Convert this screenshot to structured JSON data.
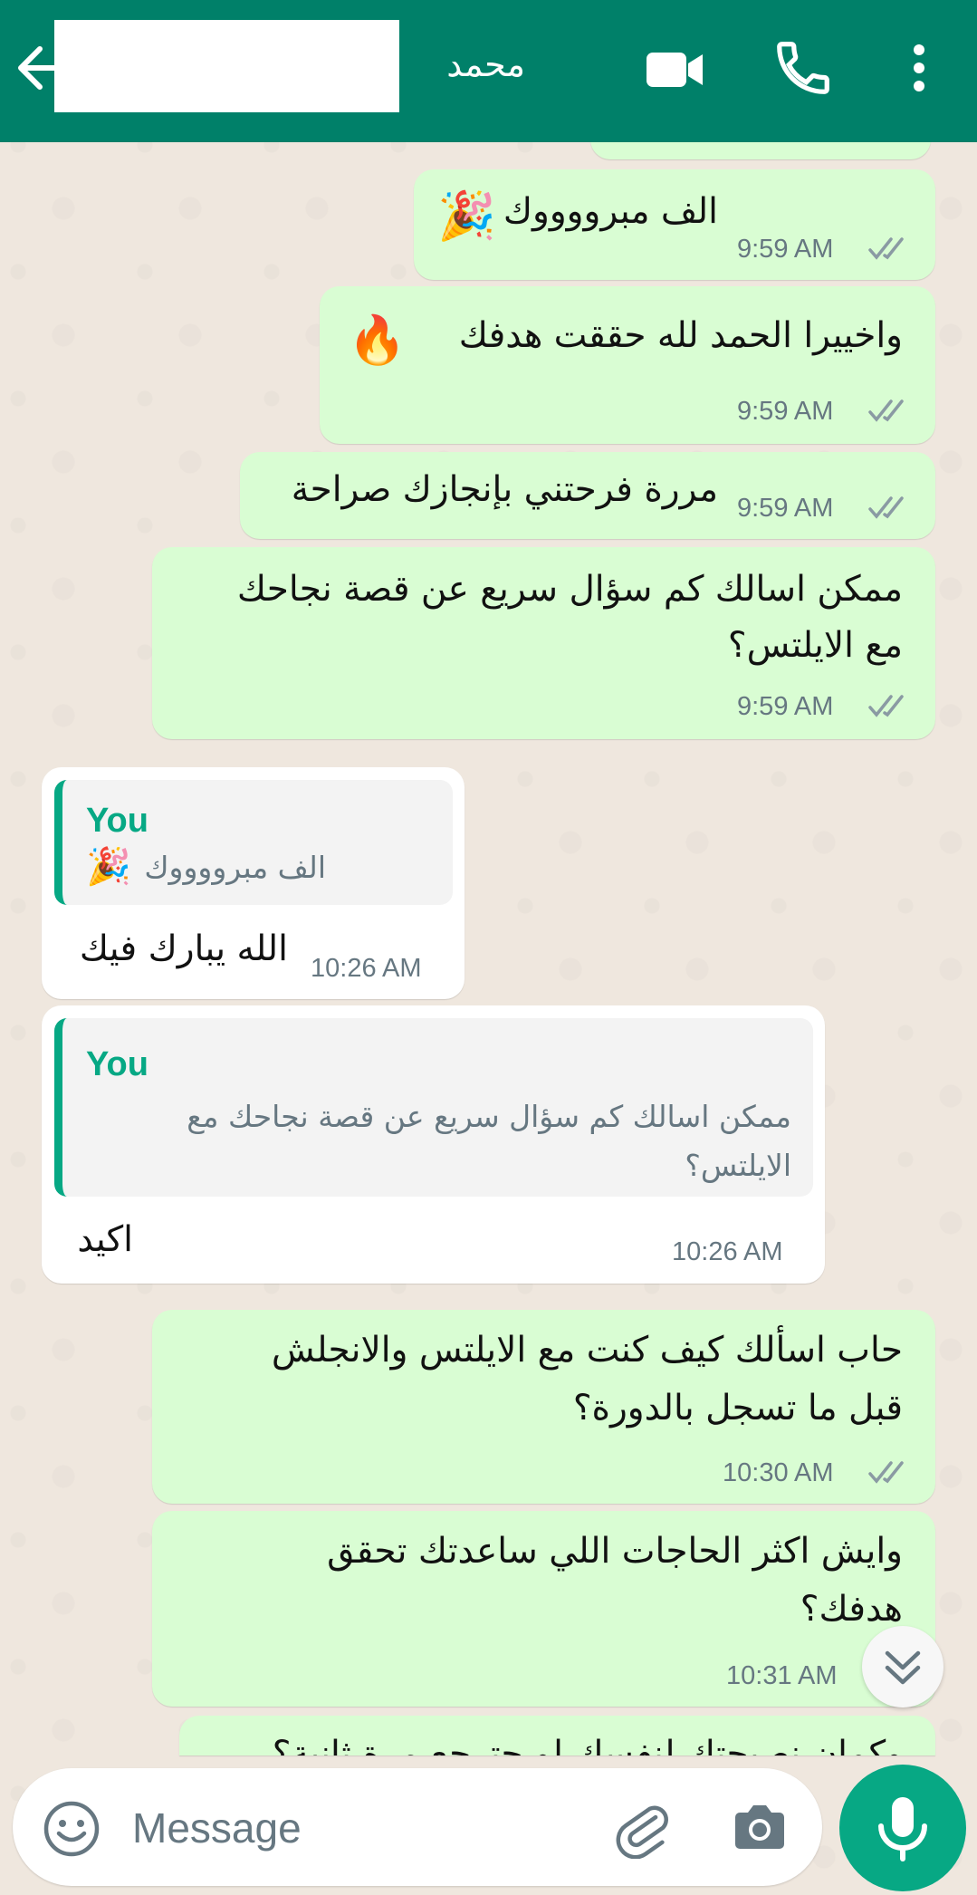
{
  "header": {
    "contact_name": "محمد",
    "back_label": "back",
    "icons": [
      "arrow-left-icon",
      "video-call-icon",
      "phone-icon",
      "more-vert-icon"
    ]
  },
  "messages": [
    {
      "text": "الف مبرووووك",
      "emoji": "🎉",
      "time": "9:59 AM",
      "direction": "out",
      "status": "read"
    },
    {
      "text": "واخييرا الحمد لله حققت هدفك",
      "emoji": "🔥",
      "time": "9:59 AM",
      "direction": "out",
      "status": "read"
    },
    {
      "text": "مررة فرحتني بإنجازك صراحة",
      "time": "9:59 AM",
      "direction": "out",
      "status": "read"
    },
    {
      "lines": [
        "ممكن اسالك كم سؤال سريع عن قصة نجاحك",
        "مع الايلتس؟"
      ],
      "time": "9:59 AM",
      "direction": "out",
      "status": "read"
    },
    {
      "quote_author": "You",
      "quote_text": "الف مبرووووك",
      "quote_emoji": "🎉",
      "text": "الله يبارك فيك",
      "time": "10:26 AM",
      "direction": "in"
    },
    {
      "quote_author": "You",
      "quote_lines": [
        "ممكن اسالك كم سؤال سريع عن قصة نجاحك مع",
        "الايلتس؟"
      ],
      "text": "اكيد",
      "time": "10:26 AM",
      "direction": "in"
    },
    {
      "lines": [
        "حاب اسألك كيف كنت مع الايلتس والانجلش",
        "قبل ما تسجل بالدورة؟"
      ],
      "time": "10:30 AM",
      "direction": "out",
      "status": "read"
    },
    {
      "lines": [
        "وايش اكثر الحاجات اللي ساعدتك تحقق",
        "هدفك؟"
      ],
      "time": "10:31 AM",
      "direction": "out",
      "status": "read"
    },
    {
      "text": "وكمان نصيحتك لنفسك لو حترجع مرة ثانية؟",
      "direction": "out"
    }
  ],
  "composer": {
    "placeholder": "Message"
  },
  "colors": {
    "header": "#008069",
    "outgoing_bubble": "#d9fdd3",
    "incoming_bubble": "#ffffff",
    "accent": "#06a884",
    "read_ticks": "#8a9aa3",
    "chat_background": "#efe7de"
  }
}
